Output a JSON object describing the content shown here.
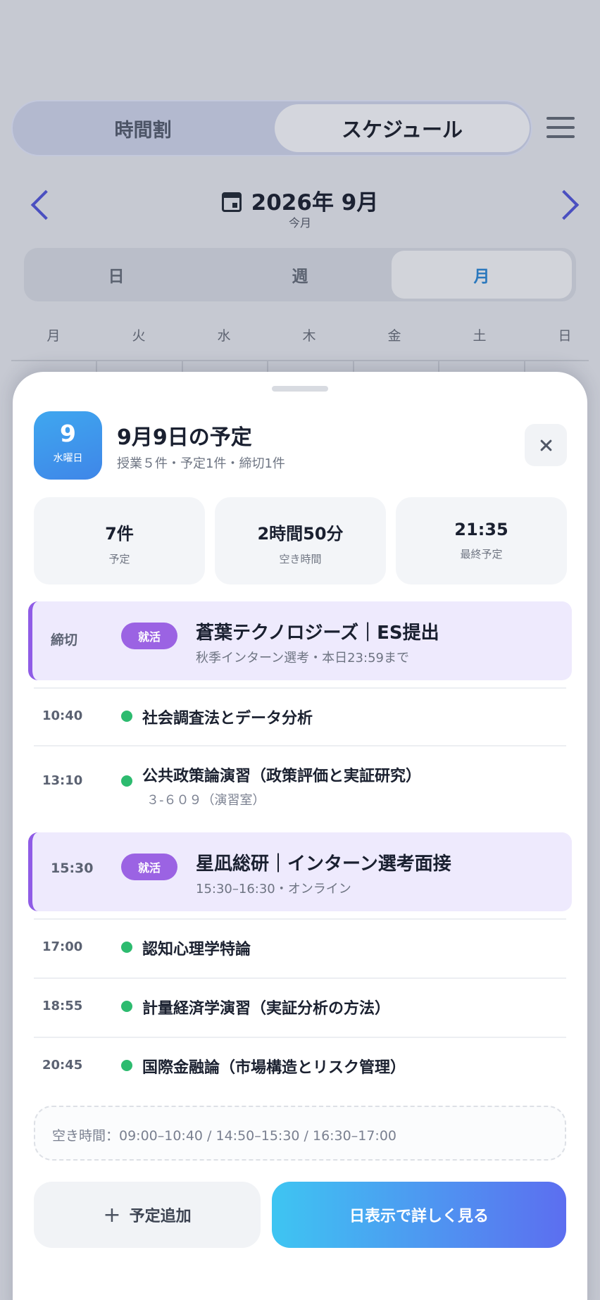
{
  "background": {
    "segment": {
      "left": "時間割",
      "right": "スケジュール"
    },
    "month": {
      "title": "2026年 9月",
      "subtitle": "今月"
    },
    "view_modes": [
      "日",
      "週",
      "月"
    ],
    "selected_view": "月",
    "weekdays": [
      "月",
      "火",
      "水",
      "木",
      "金",
      "土",
      "日"
    ]
  },
  "sheet": {
    "date": {
      "day": "9",
      "weekday": "水曜日"
    },
    "title": "9月9日の予定",
    "subtitle": "授業５件・予定1件・締切1件",
    "stats": [
      {
        "value": "7件",
        "label": "予定"
      },
      {
        "value": "2時間50分",
        "label": "空き時間"
      },
      {
        "value": "21:35",
        "label": "最終予定"
      }
    ],
    "items": [
      {
        "time": "締切",
        "tag": "就活",
        "title": "蒼葉テクノロジーズ｜ES提出",
        "sub": "秋季インターン選考・本日23:59まで",
        "highlight": true
      },
      {
        "time": "10:40",
        "title": "社会調査法とデータ分析",
        "sub": ""
      },
      {
        "time": "13:10",
        "title": "公共政策論演習（政策評価と実証研究）",
        "sub": "３-６０９（演習室）"
      },
      {
        "time": "15:30",
        "tag": "就活",
        "title": "星凪総研｜インターン選考面接",
        "sub": "15:30–16:30・オンライン",
        "highlight": true
      },
      {
        "time": "17:00",
        "title": "認知心理学特論",
        "sub": ""
      },
      {
        "time": "18:55",
        "title": "計量経済学演習（実証分析の方法）",
        "sub": ""
      },
      {
        "time": "20:45",
        "title": "国際金融論（市場構造とリスク管理）",
        "sub": ""
      }
    ],
    "free_time": "空き時間：09:00–10:40 / 14:50–15:30 / 16:30–17:00",
    "buttons": {
      "add": "予定追加",
      "detail": "日表示で詳しく見る"
    }
  },
  "colors": {
    "accent_blue": "#3f86e8",
    "job_tag": "#9b63e3",
    "class_dot": "#2dbb6f",
    "highlight_bg": "#eeeafd"
  }
}
